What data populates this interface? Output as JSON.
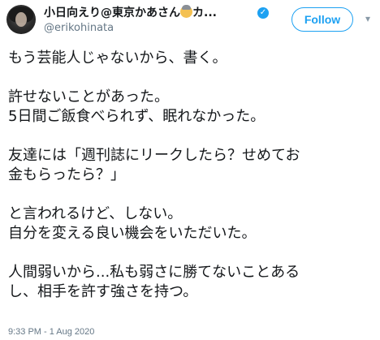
{
  "user": {
    "display_name": "小日向えり@東京かあさん",
    "name_suffix": "カ...",
    "handle": "@erikohinata",
    "verified_icon": "verified-badge-icon",
    "avatar_icon": "avatar-photo"
  },
  "follow_button": {
    "label": "Follow"
  },
  "caret_icon": "chevron-down-icon",
  "tweet": {
    "lines": [
      "もう芸能人じゃないから、書く。",
      "",
      "許せないことがあった。",
      "5日間ご飯食べられず、眠れなかった。",
      "",
      "友達には「週刊誌にリークしたら？せめてお",
      "金もらったら？」",
      "",
      "と言われるけど、しない。",
      "自分を変える良い機会をいただいた。",
      "",
      "人間弱いから...私も弱さに勝てないことある",
      "し、相手を許す強さを持つ。"
    ]
  },
  "timestamp": "9:33 PM - 1 Aug 2020",
  "colors": {
    "accent": "#1da1f2",
    "text": "#14171a",
    "muted": "#657786"
  }
}
